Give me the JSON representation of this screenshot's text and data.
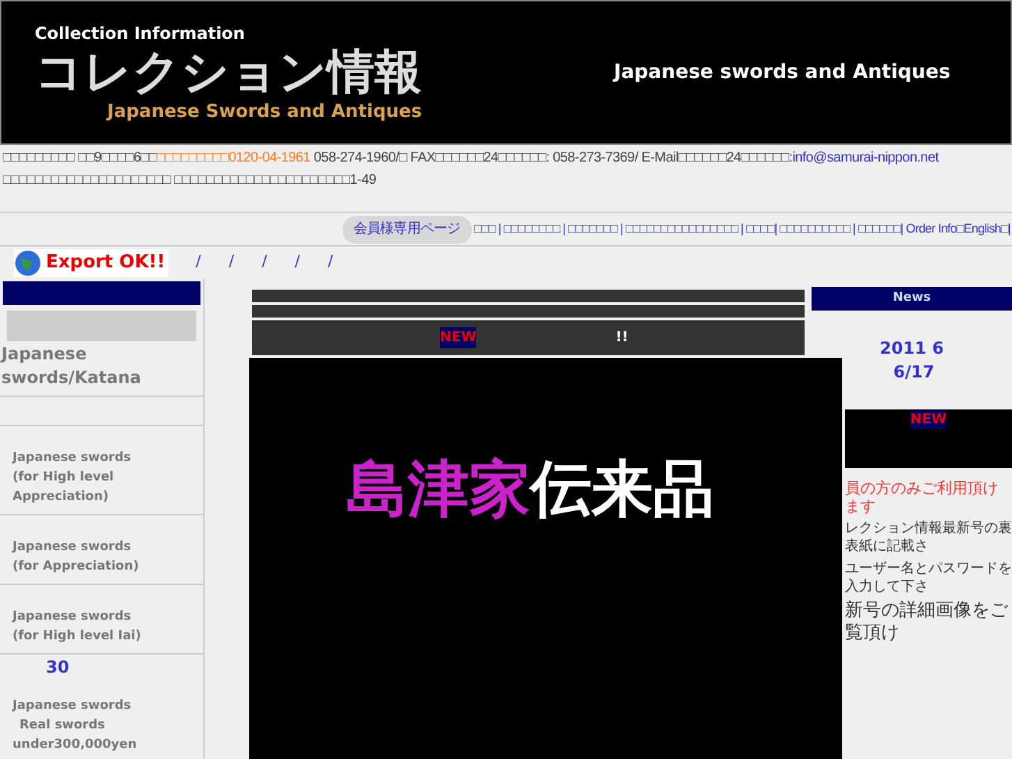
{
  "header": {
    "logo_top": "Collection Information",
    "logo_main": "コレクション情報",
    "logo_sub": "Japanese Swords and Antiques",
    "tagline": "Japanese swords and Antiques"
  },
  "contact": {
    "text_1": "□□□□□□□□□ □□9□□□□6□□",
    "phone_free": "□□□□□□□□□0120-04-1961",
    "text_2": " 058-274-1960/□ FAX□□□□□□24□□□□□□: 058-273-7369/ E-Mail□□□□□□24□□□□□□:",
    "email": "info@samurai-nippon.net",
    "text_3": " □□□□□□□□□□□□□□□□□□□□□ □□□□□□□□□□□□□□□□□□□□□□1-49"
  },
  "nav": {
    "member_button": "会員様専用ページ",
    "links": [
      "□□□ |",
      "□□□□□□□□",
      "| □□□□□□□ |",
      "□□□□□□□□□□□□□□□□",
      "| □□□□|",
      "□□□□□□□□□□",
      "| □□□□□□|",
      "Order Info□English□|"
    ]
  },
  "export_badge": "Export OK!!",
  "breadcrumb": [
    "/",
    "/",
    "/",
    "/",
    "/"
  ],
  "sidebar": {
    "title": "Japanese swords/Katana",
    "items": [
      {
        "lines": [
          "Japanese swords",
          "(for High level Appreciation)"
        ]
      },
      {
        "lines": [
          "Japanese swords",
          "(for Appreciation)"
        ]
      },
      {
        "lines": [
          "Japanese swords",
          "(for High level Iai)"
        ]
      },
      {
        "count": "30",
        "lines": [
          "Japanese swords",
          "Real swords",
          "under300,000yen"
        ]
      }
    ]
  },
  "headline": {
    "badge": "NEW",
    "text": "!!"
  },
  "banner": {
    "highlight": "島津家",
    "rest": "伝来品"
  },
  "news": {
    "title": "News",
    "date_1": "2011  6",
    "date_2": "6/17",
    "badge": "NEW"
  },
  "member_notice": {
    "heading": "員の方のみご利用頂けます",
    "line_1": "レクション情報最新号の裏表紙に記載さ",
    "line_2": "ユーザー名とパスワードを入力して下さ",
    "line_3": "新号の詳細画像をご覧頂け"
  }
}
